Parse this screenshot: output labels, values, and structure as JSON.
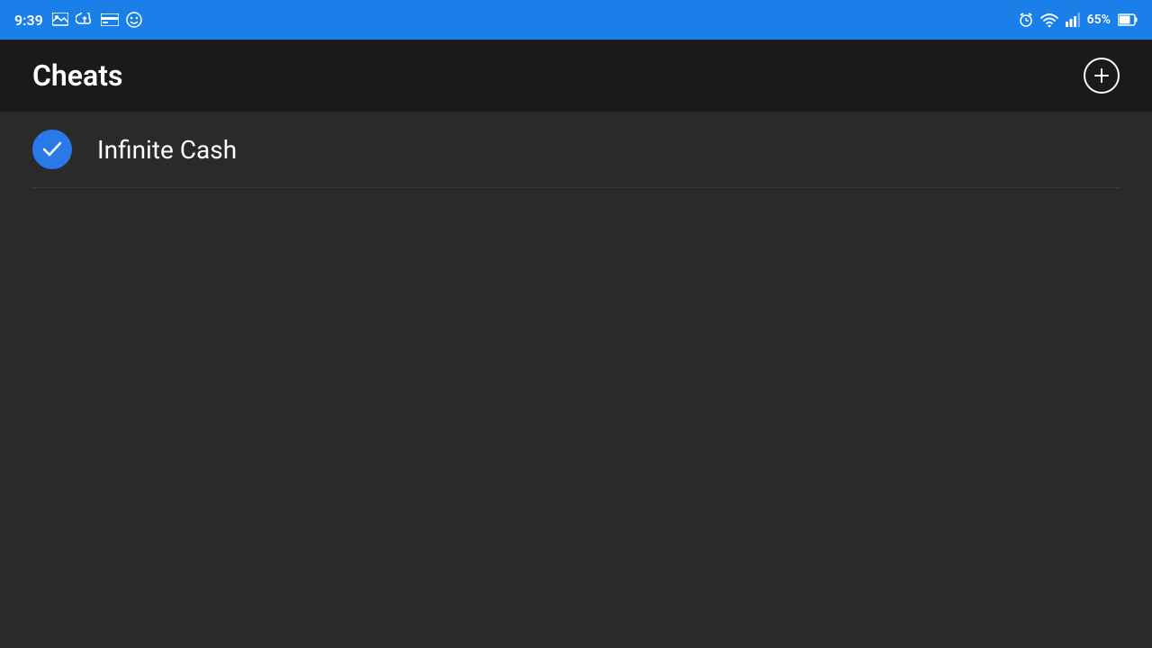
{
  "statusBar": {
    "time": "9:39",
    "battery": "65%",
    "batteryColor": "#ffffff"
  },
  "header": {
    "title": "Cheats",
    "addButtonLabel": "+"
  },
  "cheats": [
    {
      "id": 1,
      "label": "Infinite Cash",
      "enabled": true
    }
  ],
  "icons": {
    "image": "🖼",
    "cloud": "☁",
    "card": "💳",
    "face": "😊",
    "alarm": "⏰",
    "wifi": "wifi",
    "signal": "signal",
    "battery": "battery"
  }
}
